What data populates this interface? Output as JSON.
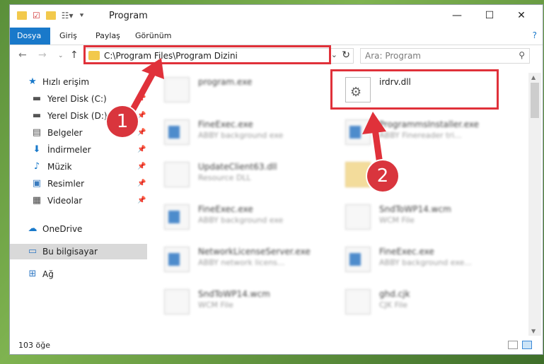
{
  "window": {
    "title": "Program"
  },
  "ribbon": {
    "tabs": [
      "Dosya",
      "Giriş",
      "Paylaş",
      "Görünüm"
    ]
  },
  "nav": {
    "address": "C:\\Program Files\\Program Dizini",
    "search_placeholder": "Ara: Program"
  },
  "sidebar": {
    "items": [
      {
        "label": "Hızlı erişim",
        "icon": "star-icon"
      },
      {
        "label": "Yerel Disk (C:)",
        "icon": "drive-icon"
      },
      {
        "label": "Yerel Disk (D:)",
        "icon": "drive-icon"
      },
      {
        "label": "Belgeler",
        "icon": "documents-icon"
      },
      {
        "label": "İndirmeler",
        "icon": "download-icon"
      },
      {
        "label": "Müzik",
        "icon": "music-icon"
      },
      {
        "label": "Resimler",
        "icon": "pictures-icon"
      },
      {
        "label": "Videolar",
        "icon": "video-icon"
      },
      {
        "label": "OneDrive",
        "icon": "cloud-icon"
      },
      {
        "label": "Bu bilgisayar",
        "icon": "computer-icon"
      },
      {
        "label": "Ağ",
        "icon": "network-icon"
      }
    ]
  },
  "files": [
    {
      "name": "program.exe",
      "desc": ""
    },
    {
      "name": "irdrv.dll",
      "desc": ""
    },
    {
      "name": "FineExec.exe",
      "desc": "ABBY background exe"
    },
    {
      "name": "ProgrammsInstaller.exe",
      "desc": "ABBY Finereader tri..."
    },
    {
      "name": "UpdateClient63.dll",
      "desc": "Resource DLL"
    },
    {
      "name": "",
      "desc": ""
    },
    {
      "name": "FineExec.exe",
      "desc": "ABBY background exe"
    },
    {
      "name": "SndToWP14.wcm",
      "desc": "WCM File"
    },
    {
      "name": "NetworkLicenseServer.exe",
      "desc": "ABBY network licens..."
    },
    {
      "name": "FineExec.exe",
      "desc": "ABBY background exe..."
    },
    {
      "name": "SndToWP14.wcm",
      "desc": "WCM File"
    },
    {
      "name": "ghd.cjk",
      "desc": "CJK File"
    }
  ],
  "status": {
    "count": "103 öğe"
  },
  "callouts": {
    "one": "1",
    "two": "2"
  },
  "colors": {
    "accent": "#1979ca",
    "highlight": "#e0313a"
  }
}
